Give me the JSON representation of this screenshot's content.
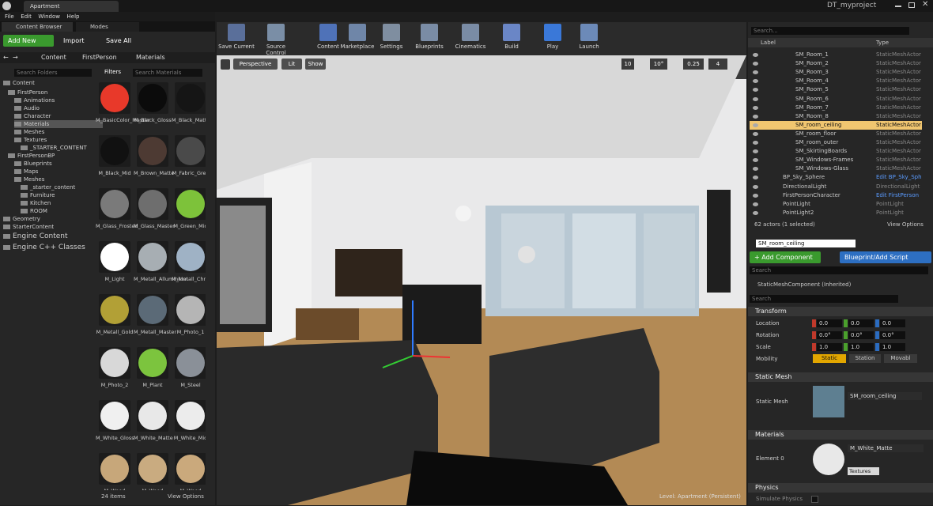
{
  "window": {
    "tab_title": "Apartment",
    "project": "DT_myproject"
  },
  "menu": [
    "File",
    "Edit",
    "Window",
    "Help"
  ],
  "panel_tabs": {
    "content_browser": "Content Browser",
    "modes": "Modes"
  },
  "cb": {
    "add_new": "Add New",
    "import": "Import",
    "save_all": "Save All",
    "path": [
      "Content",
      "FirstPerson",
      "Materials"
    ],
    "search_folders": "Search Folders",
    "filters": "Filters",
    "search_materials": "Search Materials",
    "item_count": "24 items",
    "view_options": "View Options"
  },
  "folders": [
    "Content",
    "FirstPerson",
    "Animations",
    "Audio",
    "Character",
    "Materials",
    "Meshes",
    "Textures",
    "_STARTER_CONTENT",
    "FirstPersonBP",
    "Blueprints",
    "Maps",
    "Meshes",
    "_starter_content",
    "Furniture",
    "Kitchen",
    "ROOM",
    "Geometry",
    "StarterContent",
    "Engine Content",
    "Engine C++ Classes"
  ],
  "materials": [
    {
      "name": "M_BasicColor_Master",
      "color": "#e8392a"
    },
    {
      "name": "M_Black_Gloss",
      "color": "#0b0b0b"
    },
    {
      "name": "M_Black_Matte",
      "color": "#151515"
    },
    {
      "name": "M_Black_Mid",
      "color": "#111111"
    },
    {
      "name": "M_Brown_Matte",
      "color": "#4d3a33"
    },
    {
      "name": "M_Fabric_Grey",
      "color": "#4a4a4a"
    },
    {
      "name": "M_Glass_Frosted",
      "color": "#7a7a7a"
    },
    {
      "name": "M_Glass_Master",
      "color": "#6e6e6e"
    },
    {
      "name": "M_Green_Mid",
      "color": "#7dc23a"
    },
    {
      "name": "M_Light",
      "color": "#ffffff"
    },
    {
      "name": "M_Metall_Alluminium",
      "color": "#a7aeb3"
    },
    {
      "name": "M_Metall_Chrome",
      "color": "#9fb2c5"
    },
    {
      "name": "M_Metall_Gold",
      "color": "#b2a036"
    },
    {
      "name": "M_Metall_Master",
      "color": "#5b6a77"
    },
    {
      "name": "M_Photo_1",
      "color": "#b5b5b5"
    },
    {
      "name": "M_Photo_2",
      "color": "#d8d8d8"
    },
    {
      "name": "M_Plant",
      "color": "#7cc43e"
    },
    {
      "name": "M_Steel",
      "color": "#8a9098"
    },
    {
      "name": "M_White_Gloss",
      "color": "#f0f0f0"
    },
    {
      "name": "M_White_Matte",
      "color": "#e8e8e8"
    },
    {
      "name": "M_White_Mid",
      "color": "#ececec"
    },
    {
      "name": "M_Wood",
      "color": "#c7a77a"
    },
    {
      "name": "M_Wood",
      "color": "#c9ab80"
    },
    {
      "name": "M_Wood",
      "color": "#caa97c"
    }
  ],
  "toolbar": [
    "Save Current",
    "Source Control",
    "Content",
    "Marketplace",
    "Settings",
    "Blueprints",
    "Cinematics",
    "Build",
    "Play",
    "Launch"
  ],
  "viewport": {
    "perspective": "Perspective",
    "lit": "Lit",
    "show": "Show",
    "grid": "10",
    "angle": "10°",
    "scale": "0.25",
    "speed": "4",
    "level": "Level:  Apartment (Persistent)"
  },
  "outliner": {
    "search": "Search...",
    "col_label": "Label",
    "col_type": "Type",
    "rows": [
      {
        "label": "SM_Room_1",
        "type": "StaticMeshActor"
      },
      {
        "label": "SM_Room_2",
        "type": "StaticMeshActor"
      },
      {
        "label": "SM_Room_3",
        "type": "StaticMeshActor"
      },
      {
        "label": "SM_Room_4",
        "type": "StaticMeshActor"
      },
      {
        "label": "SM_Room_5",
        "type": "StaticMeshActor"
      },
      {
        "label": "SM_Room_6",
        "type": "StaticMeshActor"
      },
      {
        "label": "SM_Room_7",
        "type": "StaticMeshActor"
      },
      {
        "label": "SM_Room_8",
        "type": "StaticMeshActor"
      },
      {
        "label": "SM_room_ceiling",
        "type": "StaticMeshActor"
      },
      {
        "label": "SM_room_floor",
        "type": "StaticMeshActor"
      },
      {
        "label": "SM_room_outer",
        "type": "StaticMeshActor"
      },
      {
        "label": "SM_SkirtingBoards",
        "type": "StaticMeshActor"
      },
      {
        "label": "SM_Windows-Frames",
        "type": "StaticMeshActor"
      },
      {
        "label": "SM_Windows-Glass",
        "type": "StaticMeshActor"
      },
      {
        "label": "BP_Sky_Sphere",
        "type": "Edit BP_Sky_Sph"
      },
      {
        "label": "DirectionalLight",
        "type": "DirectionalLight"
      },
      {
        "label": "FirstPersonCharacter",
        "type": "Edit FirstPerson"
      },
      {
        "label": "PointLight",
        "type": "PointLight"
      },
      {
        "label": "PointLight2",
        "type": "PointLight"
      }
    ],
    "status": "62 actors (1 selected)",
    "view_options": "View Options"
  },
  "details": {
    "name": "SM_room_ceiling",
    "add_component": "+ Add Component",
    "blueprint_script": "Blueprint/Add Script",
    "search": "Search",
    "component": "StaticMeshComponent (Inherited)",
    "search2": "Search",
    "transform": "Transform",
    "location": "Location",
    "rotation": "Rotation",
    "scale": "Scale",
    "mobility": "Mobility",
    "loc": [
      "0.0",
      "0.0",
      "0.0"
    ],
    "rot": [
      "0.0°",
      "0.0°",
      "0.0°"
    ],
    "scl": [
      "1.0",
      "1.0",
      "1.0"
    ],
    "mob": [
      "Static",
      "Station",
      "Movabl"
    ],
    "static_mesh_section": "Static Mesh",
    "static_mesh_label": "Static Mesh",
    "static_mesh_value": "SM_room_ceiling",
    "materials_section": "Materials",
    "element0": "Element 0",
    "material_value": "M_White_Matte",
    "textures": "Textures",
    "physics": "Physics",
    "simulate": "Simulate Physics"
  }
}
